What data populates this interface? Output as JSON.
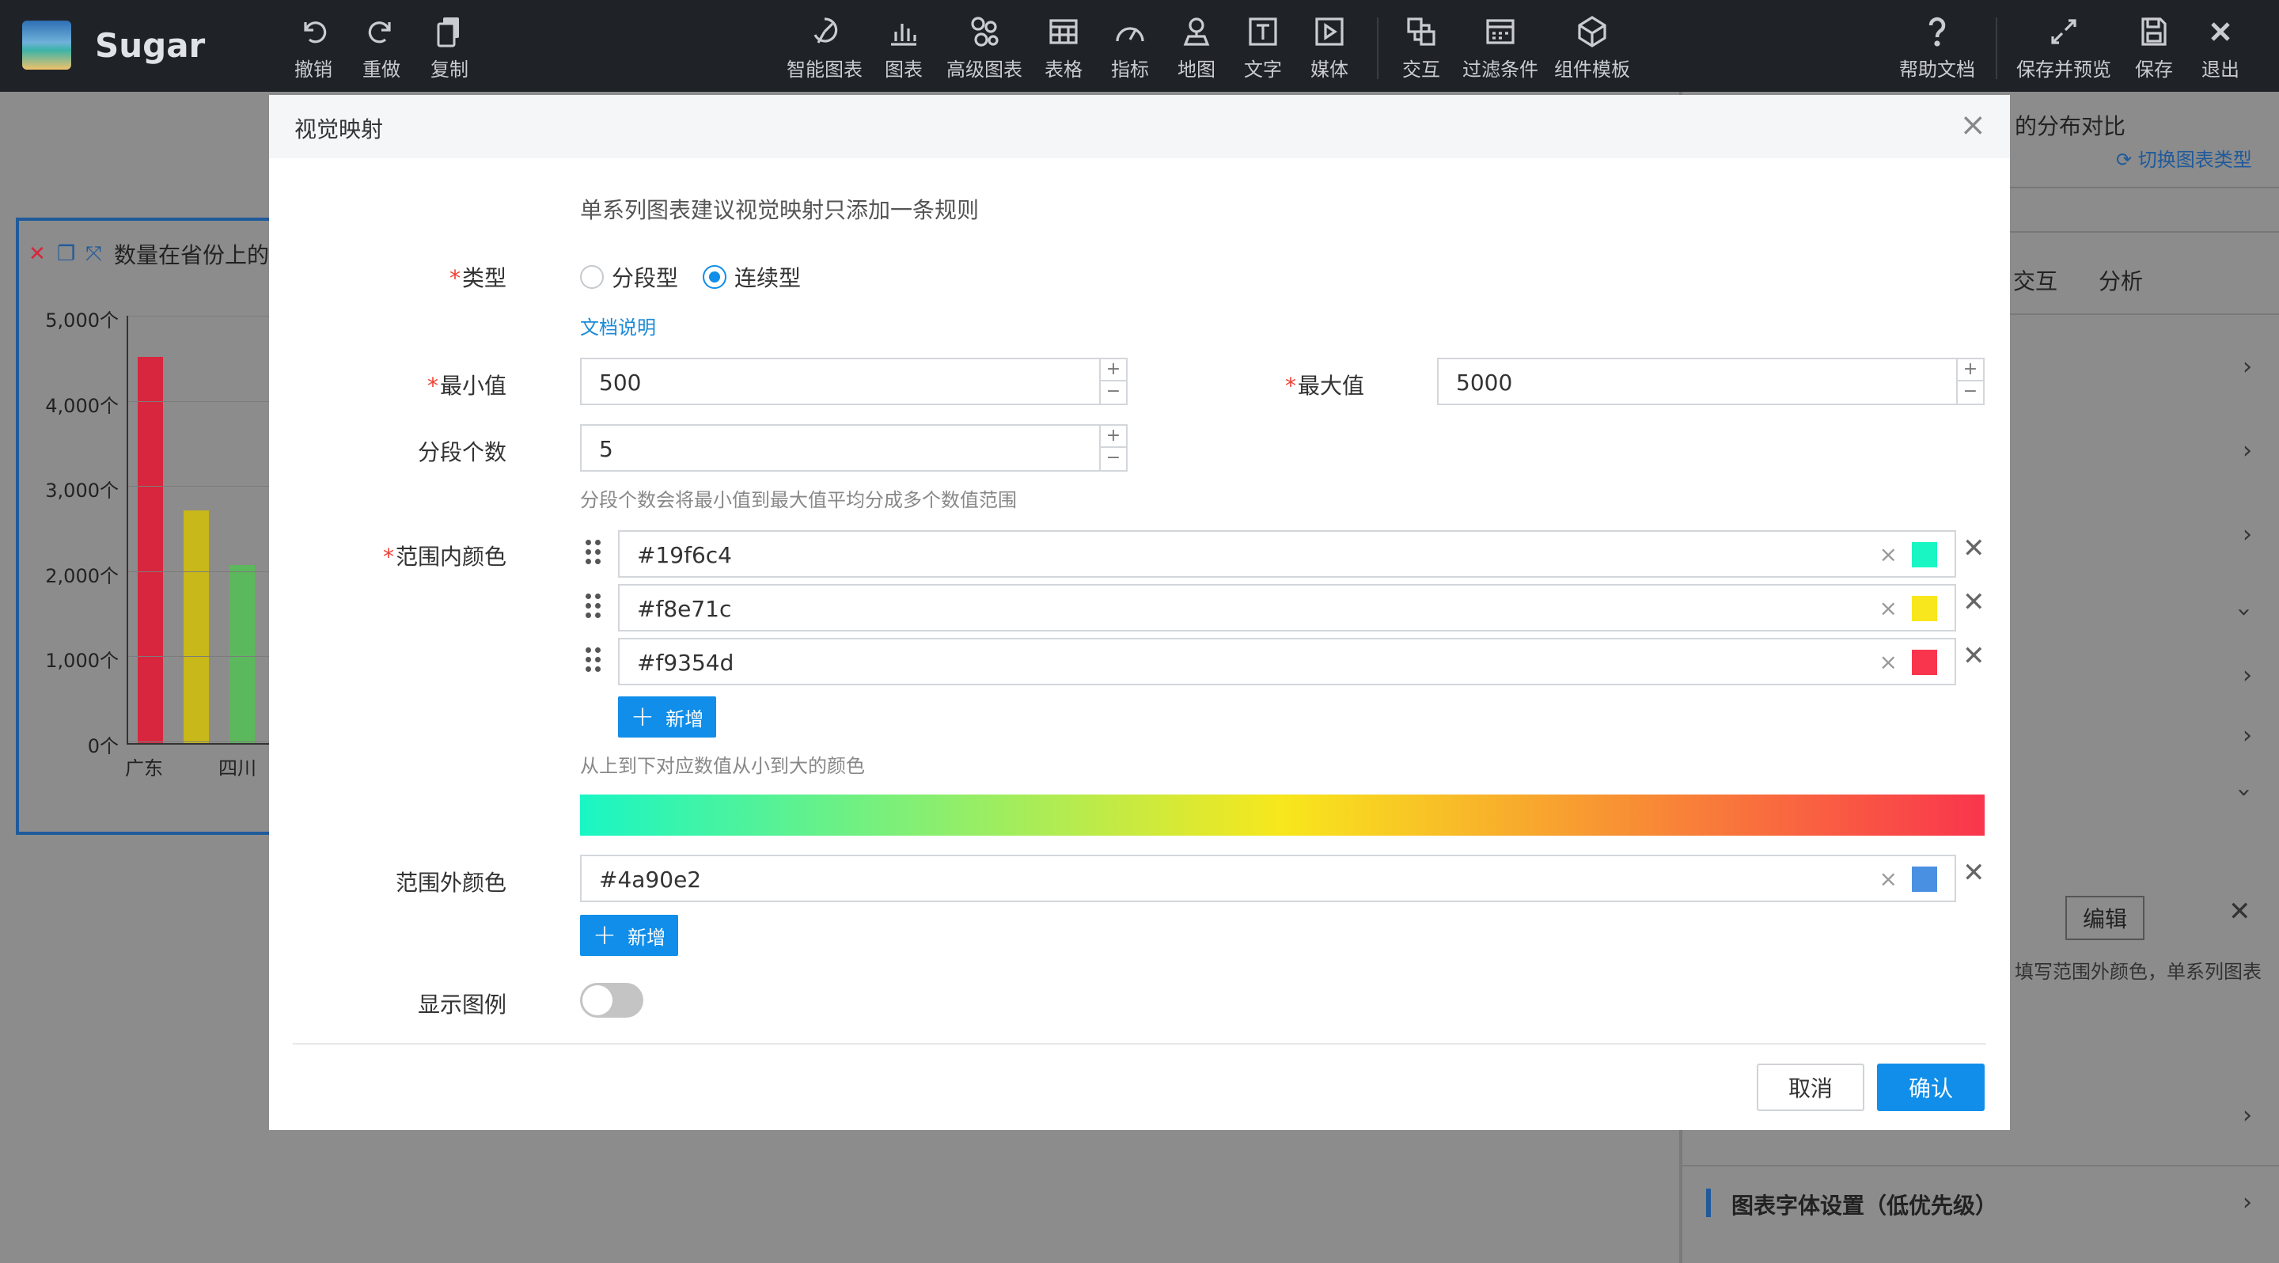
{
  "app": {
    "name": "Sugar",
    "logo_icon": "app-logo-icon"
  },
  "toolbar": {
    "left": [
      {
        "label": "撤销",
        "icon": "undo-icon"
      },
      {
        "label": "重做",
        "icon": "redo-icon"
      },
      {
        "label": "复制",
        "icon": "copy-icon"
      }
    ],
    "center": [
      {
        "label": "智能图表",
        "icon": "smart-chart-icon"
      },
      {
        "label": "图表",
        "icon": "bar-chart-icon"
      },
      {
        "label": "高级图表",
        "icon": "advanced-chart-icon"
      },
      {
        "label": "表格",
        "icon": "table-icon"
      },
      {
        "label": "指标",
        "icon": "gauge-icon"
      },
      {
        "label": "地图",
        "icon": "map-pin-icon"
      },
      {
        "label": "文字",
        "icon": "text-icon"
      },
      {
        "label": "媒体",
        "icon": "media-icon"
      },
      {
        "label": "交互",
        "icon": "interaction-icon"
      },
      {
        "label": "过滤条件",
        "icon": "filter-icon"
      },
      {
        "label": "组件模板",
        "icon": "template-icon"
      }
    ],
    "right": [
      {
        "label": "帮助文档",
        "icon": "help-icon"
      },
      {
        "label": "保存并预览",
        "icon": "expand-icon"
      },
      {
        "label": "保存",
        "icon": "save-icon"
      },
      {
        "label": "退出",
        "icon": "close-icon"
      }
    ]
  },
  "background": {
    "chart_title": "数量在省份上的",
    "y_ticks": [
      "5,000个",
      "4,000个",
      "3,000个",
      "2,000个",
      "1,000个",
      "0个"
    ],
    "x_ticks": [
      "广东",
      "四川"
    ],
    "panel_title": "的分布对比",
    "switch_chart": "切换图表类型",
    "panel_tabs": [
      "交互",
      "分析"
    ],
    "edit_button": "编辑",
    "panel_hint": "填写范围外颜色，单系列图表",
    "font_section": "图表字体设置（低优先级）"
  },
  "chart_data": {
    "type": "bar",
    "categories": [
      "广东",
      "",
      "四川"
    ],
    "values": [
      4520,
      2720,
      2080
    ],
    "colors": [
      "#d7263d",
      "#c9b81a",
      "#5cb85c"
    ],
    "ylim": [
      0,
      5000
    ]
  },
  "modal": {
    "title": "视觉映射",
    "notice": "单系列图表建议视觉映射只添加一条规则",
    "type": {
      "label": "类型",
      "options": [
        {
          "label": "分段型",
          "selected": false
        },
        {
          "label": "连续型",
          "selected": true
        }
      ],
      "doc_link": "文档说明"
    },
    "min": {
      "label": "最小值",
      "value": "500"
    },
    "max": {
      "label": "最大值",
      "value": "5000"
    },
    "segments": {
      "label": "分段个数",
      "value": "5",
      "hint": "分段个数会将最小值到最大值平均分成多个数值范围"
    },
    "in_range": {
      "label": "范围内颜色",
      "colors": [
        "#19f6c4",
        "#f8e71c",
        "#f9354d"
      ],
      "add_label": "新增",
      "hint": "从上到下对应数值从小到大的颜色"
    },
    "out_range": {
      "label": "范围外颜色",
      "color": "#4a90e2",
      "add_label": "新增"
    },
    "legend": {
      "label": "显示图例",
      "on": false
    },
    "cancel": "取消",
    "confirm": "确认"
  }
}
